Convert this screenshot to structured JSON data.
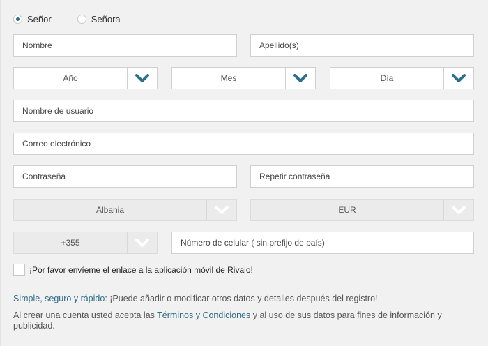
{
  "gender": {
    "options": [
      {
        "label": "Señor",
        "checked": true
      },
      {
        "label": "Señora",
        "checked": false
      }
    ]
  },
  "fields": {
    "first_name": "Nombre",
    "last_name": "Apellido(s)",
    "username": "Nombre de usuario",
    "email": "Correo electrónico",
    "password": "Contraseña",
    "password_repeat": "Repetir contraseña",
    "mobile": "Número de celular ( sin prefijo de país)"
  },
  "birthdate": {
    "year": "Año",
    "month": "Mes",
    "day": "Día"
  },
  "country": "Albania",
  "currency": "EUR",
  "phone_prefix": "+355",
  "app_link_checkbox": {
    "label": "¡Por favor envíeme el enlace a la aplicación móvil de Rivalo!",
    "checked": false
  },
  "info": {
    "line1_link": "Simple, seguro y rápido",
    "line1_text": ": ¡Puede añadir o modificar otros datos y detalles después del registro!",
    "line2_prefix": "Al crear una cuenta usted acepta las ",
    "line2_link": "Términos y Condiciones",
    "line2_suffix": " y al uso de sus datos para fines de información y publicidad."
  },
  "colors": {
    "accent": "#2b6c8c",
    "chevron_active": "#2a6f8e",
    "chevron_disabled": "#ffffff",
    "link": "#2e6d87"
  },
  "icons": {
    "select_toggle": "chevron-down-icon"
  }
}
